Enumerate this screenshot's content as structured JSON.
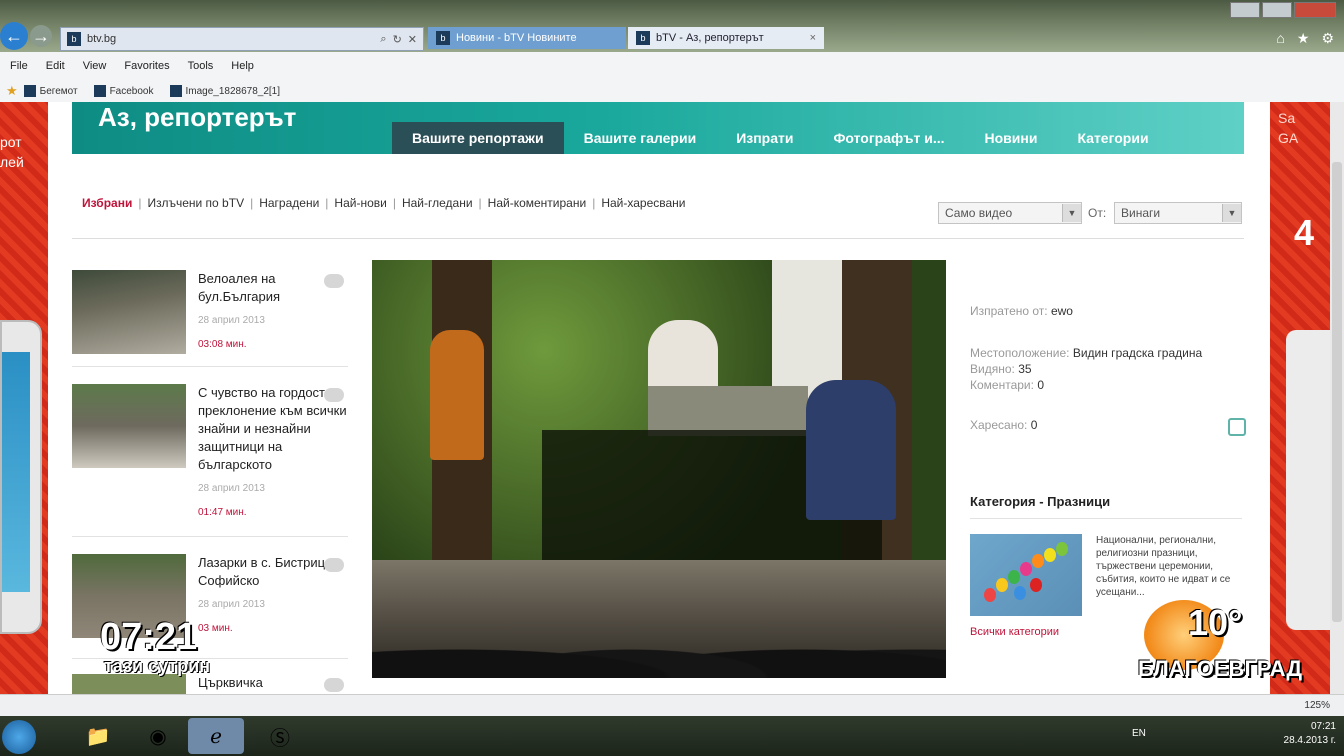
{
  "browser": {
    "address": "btv.bg",
    "tabs": [
      {
        "label": "Новини - bTV Новините"
      },
      {
        "label": "bTV - Аз, репортерът",
        "close": "×"
      }
    ],
    "menu": [
      "File",
      "Edit",
      "View",
      "Favorites",
      "Tools",
      "Help"
    ],
    "favorites": [
      "Бегемот",
      "Facebook",
      "Image_1828678_2[1]"
    ],
    "zoom": "125%"
  },
  "site": {
    "logo": "Аз, репортерът",
    "nav": [
      "Вашите репортажи",
      "Вашите галерии",
      "Изпрати",
      "Фотографът и...",
      "Новини",
      "Категории"
    ],
    "subnav": [
      "Избрани",
      "Излъчени по bTV",
      "Наградени",
      "Най-нови",
      "Най-гледани",
      "Най-коментирани",
      "Най-харесвани"
    ],
    "filter_type": "Само видео",
    "filter_from_label": "От:",
    "filter_time": "Винаги"
  },
  "items": [
    {
      "title": "Велоалея на бул.България",
      "date": "28 април 2013",
      "duration": "03:08 мин."
    },
    {
      "title": "С чувство на гордост и преклонение към всички знайни и незнайни защитници на българското",
      "date": "28 април 2013",
      "duration": "01:47 мин."
    },
    {
      "title": "Лазарки в с. Бистрица - Софийско",
      "date": "28 април 2013",
      "duration": "03 мин."
    },
    {
      "title": "Църквичка",
      "date": "",
      "duration": ""
    }
  ],
  "meta": {
    "uploaded_by_label": "Изпратено от:",
    "uploaded_by": "ewo",
    "location_label": "Местоположение:",
    "location": "Видин градска градина",
    "views_label": "Видяно:",
    "views": "35",
    "comments_label": "Коментари:",
    "comments": "0",
    "likes_label": "Харесано:",
    "likes": "0"
  },
  "category": {
    "heading": "Категория - Празници",
    "text": "Национални, регионални, религиозни празници, тържествени церемонии, събития, които не идват и се усещани...",
    "all_link": "Всички категории"
  },
  "overlay": {
    "time": "07:21",
    "subtitle": "тази сутрин",
    "temp": "10°",
    "city": "БЛАГОЕВГРАД"
  },
  "taskbar": {
    "lang": "EN",
    "clock": "07:21",
    "date": "28.4.2013 г."
  },
  "ads": {
    "left_text": "рот\nлей",
    "right_text": "Sa\nGA",
    "right_big": "4"
  }
}
